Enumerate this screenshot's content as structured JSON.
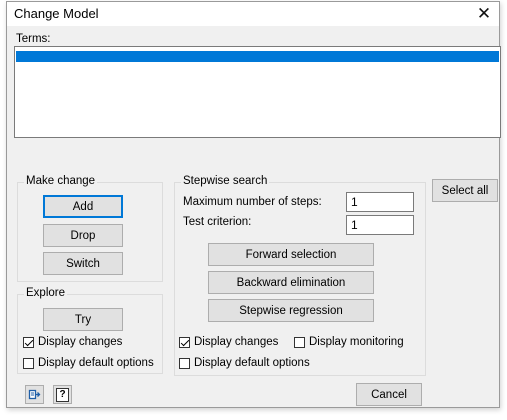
{
  "window": {
    "title": "Change Model"
  },
  "terms": {
    "label": "Terms:"
  },
  "make_change": {
    "title": "Make change",
    "add_label": "Add",
    "drop_label": "Drop",
    "switch_label": "Switch"
  },
  "explore": {
    "title": "Explore",
    "try_label": "Try",
    "display_changes": {
      "label": "Display changes",
      "checked": true
    },
    "display_default_options": {
      "label": "Display default options",
      "checked": false
    }
  },
  "stepwise": {
    "title": "Stepwise search",
    "max_steps_label": "Maximum number of steps:",
    "max_steps_value": "1",
    "test_criterion_label": "Test criterion:",
    "test_criterion_value": "1",
    "forward_label": "Forward selection",
    "backward_label": "Backward elimination",
    "stepwise_label": "Stepwise regression",
    "display_changes": {
      "label": "Display changes",
      "checked": true
    },
    "display_monitoring": {
      "label": "Display monitoring",
      "checked": false
    },
    "display_default_options": {
      "label": "Display default options",
      "checked": false
    }
  },
  "select_all_label": "Select all",
  "cancel_label": "Cancel",
  "footer": {
    "icons": [
      "save-defaults-icon",
      "help-icon"
    ],
    "help_glyph": "?"
  },
  "colors": {
    "selection": "#0078d7",
    "default_button_border": "#0078d7"
  }
}
